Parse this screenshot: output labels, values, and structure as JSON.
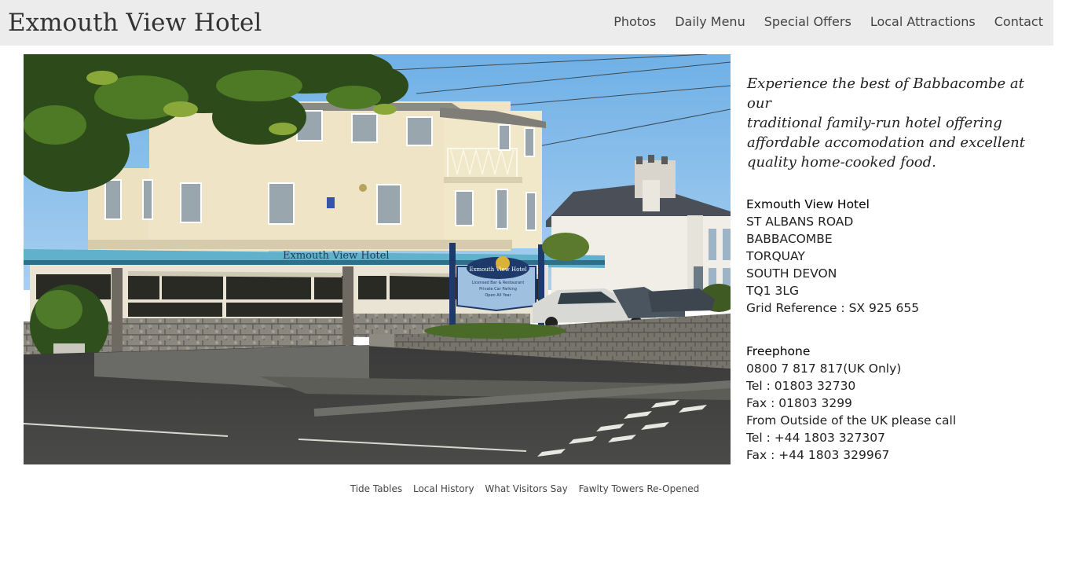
{
  "header": {
    "title": "Exmouth View Hotel",
    "nav": [
      "Photos",
      "Daily Menu",
      "Special Offers",
      "Local Attractions",
      "Contact"
    ]
  },
  "photo": {
    "sign_text": "Exmouth View Hotel",
    "sign_board": [
      "Exmouth View Hotel",
      "Licensed Bar & Restaurant",
      "Private Car Parking",
      "Open All Year"
    ]
  },
  "intro": {
    "tagline_lines": [
      "Experience the best of Babbacombe at our",
      "traditional family-run hotel offering",
      "affordable accomodation and excellent",
      "quality home-cooked food."
    ]
  },
  "address": {
    "heading": "Exmouth View Hotel",
    "lines": [
      "ST ALBANS ROAD",
      "BABBACOMBE",
      "TORQUAY",
      "SOUTH DEVON",
      "TQ1 3LG",
      "Grid Reference : SX 925 655"
    ]
  },
  "contact": {
    "heading": "Freephone",
    "lines": [
      "0800 7 817 817(UK Only)",
      "Tel : 01803 32730",
      "Fax : 01803 3299",
      "From Outside of the UK please call",
      "Tel : +44 1803 327307",
      "Fax : +44 1803 329967"
    ]
  },
  "footer": {
    "links": [
      "Tide Tables",
      "Local History",
      "What Visitors Say",
      "Fawlty Towers Re-Opened"
    ]
  }
}
